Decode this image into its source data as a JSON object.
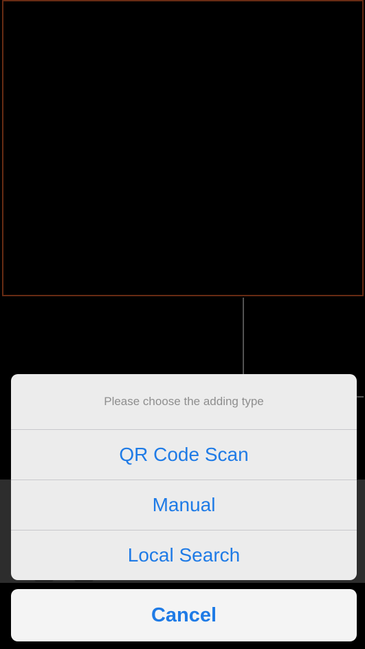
{
  "action_sheet": {
    "title": "Please choose the adding type",
    "options": [
      {
        "label": "QR Code Scan"
      },
      {
        "label": "Manual"
      },
      {
        "label": "Local Search"
      }
    ],
    "cancel_label": "Cancel"
  },
  "colors": {
    "accent": "#1f7be6",
    "selected_border": "#8a3a1a",
    "sheet_background": "#ececec"
  }
}
